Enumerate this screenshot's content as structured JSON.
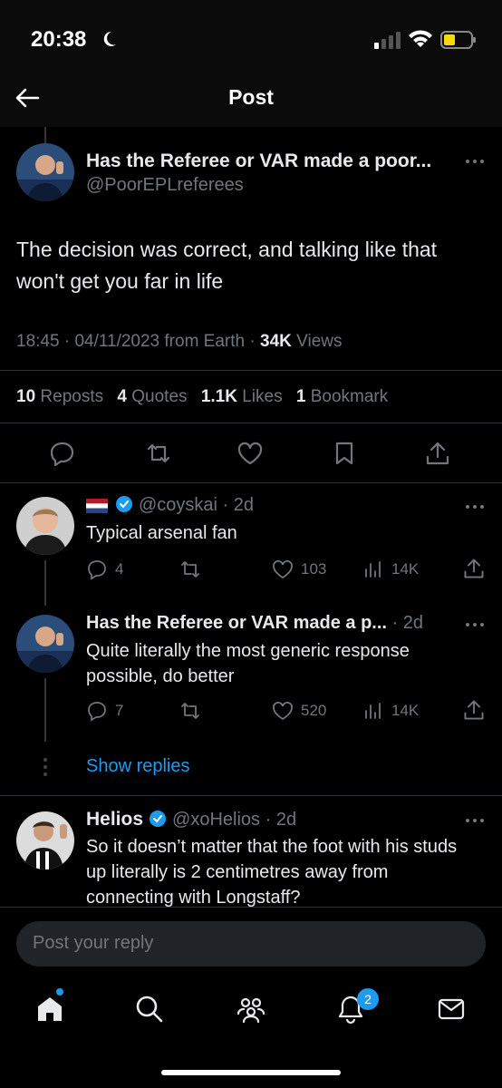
{
  "status_bar": {
    "time": "20:38"
  },
  "header": {
    "title": "Post"
  },
  "main_post": {
    "author_name": "Has the Referee or VAR made a poor...",
    "author_handle": "@PoorEPLreferees",
    "text": "The decision was correct, and talking like that won't get you far in life",
    "time": "18:45",
    "date": "04/11/2023",
    "source": "from Earth",
    "views_count": "34K",
    "views_label": "Views",
    "reposts_count": "10",
    "reposts_label": "Reposts",
    "quotes_count": "4",
    "quotes_label": "Quotes",
    "likes_count": "1.1K",
    "likes_label": "Likes",
    "bookmarks_count": "1",
    "bookmarks_label": "Bookmark"
  },
  "replies": [
    {
      "handle": "@coyskai",
      "age": "2d",
      "text": "Typical arsenal fan",
      "reply_count": "4",
      "like_count": "103",
      "view_count": "14K"
    },
    {
      "author_name": "Has the Referee or VAR made a p...",
      "age": "2d",
      "text": "Quite literally the most generic response possible, do better",
      "reply_count": "7",
      "like_count": "520",
      "view_count": "14K"
    },
    {
      "author_name": "Helios",
      "handle": "@xoHelios",
      "age": "2d",
      "text": "So it doesn’t matter that the foot with his studs up literally is 2 centimetres away from connecting with Longstaff?"
    }
  ],
  "show_replies": "Show replies",
  "reply_input": {
    "placeholder": "Post your reply"
  },
  "bottom_nav": {
    "notifications_badge": "2"
  },
  "colors": {
    "accent": "#1d9bf0",
    "background": "#000000",
    "muted": "#71767b"
  }
}
